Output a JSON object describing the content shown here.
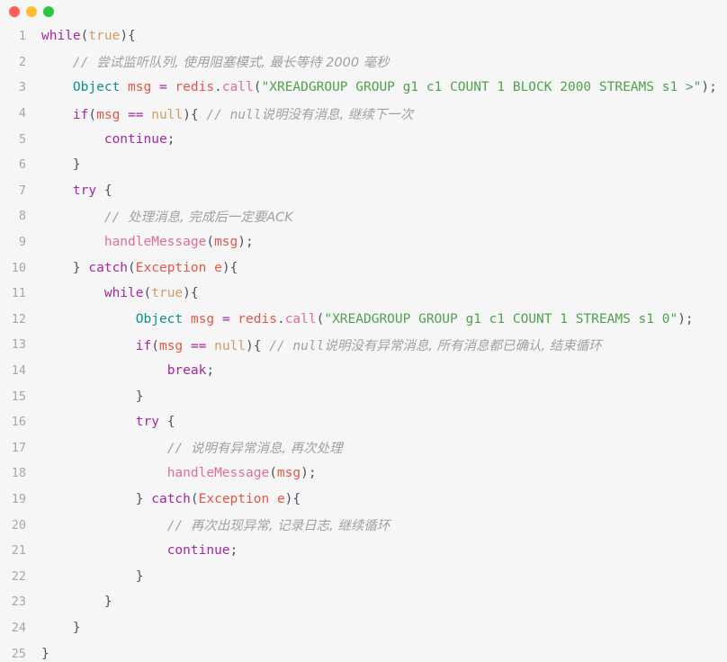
{
  "window": {
    "controls": [
      {
        "name": "close",
        "color": "#ff5f56"
      },
      {
        "name": "minimize",
        "color": "#ffbd2e"
      },
      {
        "name": "maximize",
        "color": "#27c93f"
      }
    ]
  },
  "editor": {
    "language": "java",
    "theme": "one-light",
    "line_count": 25,
    "gutter": [
      "1",
      "2",
      "3",
      "4",
      "5",
      "6",
      "7",
      "8",
      "9",
      "10",
      "11",
      "12",
      "13",
      "14",
      "15",
      "16",
      "17",
      "18",
      "19",
      "20",
      "21",
      "22",
      "23",
      "24",
      "25"
    ],
    "lines": [
      {
        "n": "1",
        "indent": 0,
        "tokens": [
          {
            "t": "while",
            "c": "kw"
          },
          {
            "t": "(",
            "c": "pn"
          },
          {
            "t": "true",
            "c": "lit"
          },
          {
            "t": ")",
            "c": "pn"
          },
          {
            "t": "{",
            "c": "pn"
          }
        ]
      },
      {
        "n": "2",
        "indent": 1,
        "tokens": [
          {
            "t": "// ",
            "c": "cmt"
          },
          {
            "t": "尝试监听队列, 使用阻塞模式, 最长等待 2000 毫秒",
            "c": "cmt-cn"
          }
        ]
      },
      {
        "n": "3",
        "indent": 1,
        "tokens": [
          {
            "t": "Object",
            "c": "type"
          },
          {
            "t": " ",
            "c": "pn"
          },
          {
            "t": "msg",
            "c": "var"
          },
          {
            "t": " ",
            "c": "pn"
          },
          {
            "t": "=",
            "c": "op"
          },
          {
            "t": " ",
            "c": "pn"
          },
          {
            "t": "redis",
            "c": "var"
          },
          {
            "t": ".",
            "c": "pn"
          },
          {
            "t": "call",
            "c": "fn"
          },
          {
            "t": "(",
            "c": "pn"
          },
          {
            "t": "\"XREADGROUP GROUP g1 c1 COUNT 1 BLOCK 2000 STREAMS s1 >\"",
            "c": "str"
          },
          {
            "t": ")",
            "c": "pn"
          },
          {
            "t": ";",
            "c": "pn"
          }
        ]
      },
      {
        "n": "4",
        "indent": 1,
        "tokens": [
          {
            "t": "if",
            "c": "kw"
          },
          {
            "t": "(",
            "c": "pn"
          },
          {
            "t": "msg",
            "c": "var"
          },
          {
            "t": " ",
            "c": "pn"
          },
          {
            "t": "==",
            "c": "op"
          },
          {
            "t": " ",
            "c": "pn"
          },
          {
            "t": "null",
            "c": "lit"
          },
          {
            "t": ")",
            "c": "pn"
          },
          {
            "t": "{",
            "c": "pn"
          },
          {
            "t": " ",
            "c": "pn"
          },
          {
            "t": "// null",
            "c": "cmt"
          },
          {
            "t": "说明没有消息, 继续下一次",
            "c": "cmt-cn"
          }
        ]
      },
      {
        "n": "5",
        "indent": 2,
        "tokens": [
          {
            "t": "continue",
            "c": "kw"
          },
          {
            "t": ";",
            "c": "pn"
          }
        ]
      },
      {
        "n": "6",
        "indent": 1,
        "tokens": [
          {
            "t": "}",
            "c": "pn"
          }
        ]
      },
      {
        "n": "7",
        "indent": 1,
        "tokens": [
          {
            "t": "try",
            "c": "kw"
          },
          {
            "t": " ",
            "c": "pn"
          },
          {
            "t": "{",
            "c": "pn"
          }
        ]
      },
      {
        "n": "8",
        "indent": 2,
        "tokens": [
          {
            "t": "// ",
            "c": "cmt"
          },
          {
            "t": "处理消息, 完成后一定要ACK",
            "c": "cmt-cn"
          }
        ]
      },
      {
        "n": "9",
        "indent": 2,
        "tokens": [
          {
            "t": "handleMessage",
            "c": "fn"
          },
          {
            "t": "(",
            "c": "pn"
          },
          {
            "t": "msg",
            "c": "var"
          },
          {
            "t": ")",
            "c": "pn"
          },
          {
            "t": ";",
            "c": "pn"
          }
        ]
      },
      {
        "n": "10",
        "indent": 1,
        "tokens": [
          {
            "t": "}",
            "c": "pn"
          },
          {
            "t": " ",
            "c": "pn"
          },
          {
            "t": "catch",
            "c": "kw"
          },
          {
            "t": "(",
            "c": "pn"
          },
          {
            "t": "Exception",
            "c": "var"
          },
          {
            "t": " ",
            "c": "pn"
          },
          {
            "t": "e",
            "c": "var"
          },
          {
            "t": ")",
            "c": "pn"
          },
          {
            "t": "{",
            "c": "pn"
          }
        ]
      },
      {
        "n": "11",
        "indent": 2,
        "tokens": [
          {
            "t": "while",
            "c": "kw"
          },
          {
            "t": "(",
            "c": "pn"
          },
          {
            "t": "true",
            "c": "lit"
          },
          {
            "t": ")",
            "c": "pn"
          },
          {
            "t": "{",
            "c": "pn"
          }
        ]
      },
      {
        "n": "12",
        "indent": 3,
        "tokens": [
          {
            "t": "Object",
            "c": "type"
          },
          {
            "t": " ",
            "c": "pn"
          },
          {
            "t": "msg",
            "c": "var"
          },
          {
            "t": " ",
            "c": "pn"
          },
          {
            "t": "=",
            "c": "op"
          },
          {
            "t": " ",
            "c": "pn"
          },
          {
            "t": "redis",
            "c": "var"
          },
          {
            "t": ".",
            "c": "pn"
          },
          {
            "t": "call",
            "c": "fn"
          },
          {
            "t": "(",
            "c": "pn"
          },
          {
            "t": "\"XREADGROUP GROUP g1 c1 COUNT 1 STREAMS s1 0\"",
            "c": "str"
          },
          {
            "t": ")",
            "c": "pn"
          },
          {
            "t": ";",
            "c": "pn"
          }
        ]
      },
      {
        "n": "13",
        "indent": 3,
        "tokens": [
          {
            "t": "if",
            "c": "kw"
          },
          {
            "t": "(",
            "c": "pn"
          },
          {
            "t": "msg",
            "c": "var"
          },
          {
            "t": " ",
            "c": "pn"
          },
          {
            "t": "==",
            "c": "op"
          },
          {
            "t": " ",
            "c": "pn"
          },
          {
            "t": "null",
            "c": "lit"
          },
          {
            "t": ")",
            "c": "pn"
          },
          {
            "t": "{",
            "c": "pn"
          },
          {
            "t": " ",
            "c": "pn"
          },
          {
            "t": "// null",
            "c": "cmt"
          },
          {
            "t": "说明没有异常消息, 所有消息都已确认, 结束循环",
            "c": "cmt-cn"
          }
        ]
      },
      {
        "n": "14",
        "indent": 4,
        "tokens": [
          {
            "t": "break",
            "c": "kw"
          },
          {
            "t": ";",
            "c": "pn"
          }
        ]
      },
      {
        "n": "15",
        "indent": 3,
        "tokens": [
          {
            "t": "}",
            "c": "pn"
          }
        ]
      },
      {
        "n": "16",
        "indent": 3,
        "tokens": [
          {
            "t": "try",
            "c": "kw"
          },
          {
            "t": " ",
            "c": "pn"
          },
          {
            "t": "{",
            "c": "pn"
          }
        ]
      },
      {
        "n": "17",
        "indent": 4,
        "tokens": [
          {
            "t": "// ",
            "c": "cmt"
          },
          {
            "t": "说明有异常消息, 再次处理",
            "c": "cmt-cn"
          }
        ]
      },
      {
        "n": "18",
        "indent": 4,
        "tokens": [
          {
            "t": "handleMessage",
            "c": "fn"
          },
          {
            "t": "(",
            "c": "pn"
          },
          {
            "t": "msg",
            "c": "var"
          },
          {
            "t": ")",
            "c": "pn"
          },
          {
            "t": ";",
            "c": "pn"
          }
        ]
      },
      {
        "n": "19",
        "indent": 3,
        "tokens": [
          {
            "t": "}",
            "c": "pn"
          },
          {
            "t": " ",
            "c": "pn"
          },
          {
            "t": "catch",
            "c": "kw"
          },
          {
            "t": "(",
            "c": "pn"
          },
          {
            "t": "Exception",
            "c": "var"
          },
          {
            "t": " ",
            "c": "pn"
          },
          {
            "t": "e",
            "c": "var"
          },
          {
            "t": ")",
            "c": "pn"
          },
          {
            "t": "{",
            "c": "pn"
          }
        ]
      },
      {
        "n": "20",
        "indent": 4,
        "tokens": [
          {
            "t": "// ",
            "c": "cmt"
          },
          {
            "t": "再次出现异常, 记录日志, 继续循环",
            "c": "cmt-cn"
          }
        ]
      },
      {
        "n": "21",
        "indent": 4,
        "tokens": [
          {
            "t": "continue",
            "c": "kw"
          },
          {
            "t": ";",
            "c": "pn"
          }
        ]
      },
      {
        "n": "22",
        "indent": 3,
        "tokens": [
          {
            "t": "}",
            "c": "pn"
          }
        ]
      },
      {
        "n": "23",
        "indent": 2,
        "tokens": [
          {
            "t": "}",
            "c": "pn"
          }
        ]
      },
      {
        "n": "24",
        "indent": 1,
        "tokens": [
          {
            "t": "}",
            "c": "pn"
          }
        ]
      },
      {
        "n": "25",
        "indent": 0,
        "tokens": [
          {
            "t": "}",
            "c": "pn"
          }
        ]
      }
    ]
  },
  "colors": {
    "background": "#f6f6f6",
    "gutter_text": "#a7a7a7",
    "keyword": "#a626a4",
    "type": "#0e8f8f",
    "variable": "#e45649",
    "function": "#e06c9a",
    "string": "#50a14f",
    "literal": "#d19a66",
    "punctuation": "#4b5263",
    "comment": "#a0a1a7"
  }
}
